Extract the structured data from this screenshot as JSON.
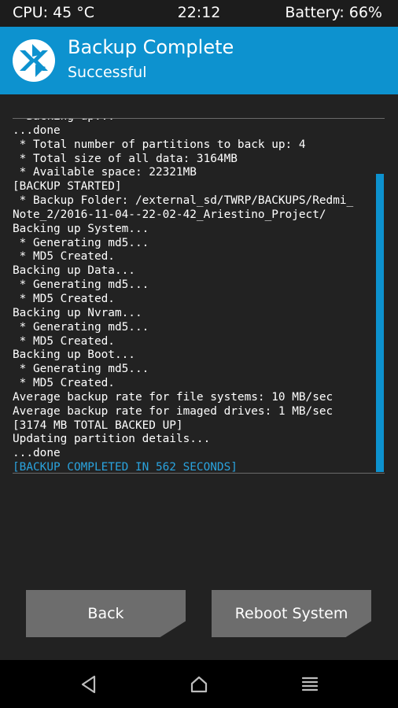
{
  "status": {
    "cpu": "CPU: 45 °C",
    "time": "22:12",
    "battery": "Battery: 66%"
  },
  "header": {
    "logo_icon": "twrp-logo-icon",
    "title": "Backup Complete",
    "subtitle": "Successful"
  },
  "console": {
    "lines": [
      "* Backing up...",
      "...done",
      " * Total number of partitions to back up: 4",
      " * Total size of all data: 3164MB",
      " * Available space: 22321MB",
      "[BACKUP STARTED]",
      " * Backup Folder: /external_sd/TWRP/BACKUPS/Redmi_",
      "Note_2/2016-11-04--22-02-42_Ariestino_Project/",
      "Backing up System...",
      " * Generating md5...",
      " * MD5 Created.",
      "Backing up Data...",
      " * Generating md5...",
      " * MD5 Created.",
      "Backing up Nvram...",
      " * Generating md5...",
      " * MD5 Created.",
      "Backing up Boot...",
      " * Generating md5...",
      " * MD5 Created.",
      "Average backup rate for file systems: 10 MB/sec",
      "Average backup rate for imaged drives: 1 MB/sec",
      "[3174 MB TOTAL BACKED UP]",
      "Updating partition details...",
      "...done",
      "[BACKUP COMPLETED IN 562 SECONDS]"
    ]
  },
  "buttons": {
    "back": "Back",
    "reboot": "Reboot System"
  },
  "nav": {
    "back_icon": "back-triangle-icon",
    "home_icon": "home-icon",
    "menu_icon": "menu-icon"
  },
  "colors": {
    "accent": "#0d92cf",
    "success_text": "#2aa3de",
    "background": "#222222",
    "button": "#6d6d6d"
  }
}
